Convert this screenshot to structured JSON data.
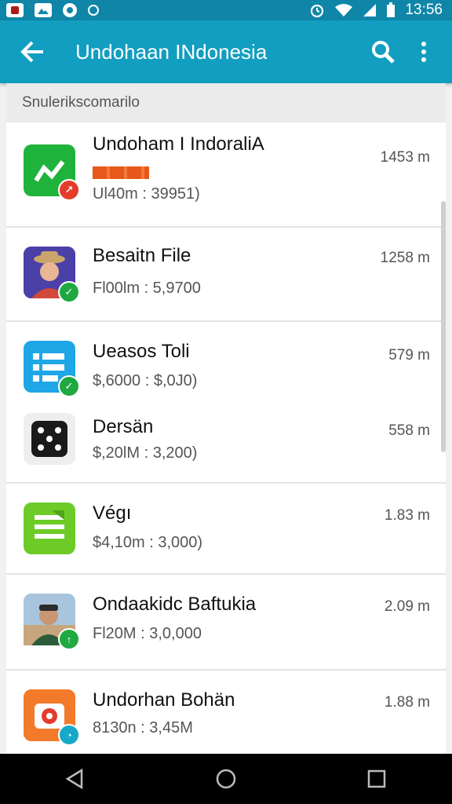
{
  "status_bar": {
    "time": "13:56",
    "left_icons": [
      "notification-app-icon",
      "gallery-icon",
      "messenger-icon",
      "dot-icon"
    ],
    "right_icons": [
      "alarm-icon",
      "wifi-icon",
      "signal-icon",
      "battery-icon"
    ]
  },
  "app_bar": {
    "title": "Undohaan INdonesia",
    "color": "#129ec0"
  },
  "section_header": "Snulerikscomarilo",
  "apps": [
    {
      "name": "Undoham I IndoraliA",
      "sub": "Ul40m : 39951)",
      "size": "1453 m",
      "icon": "green-chart-icon",
      "badge": "red-arrow-badge",
      "progress": true
    },
    {
      "name": "Besaitn File",
      "sub": "Fl00lm : 5,9700",
      "size": "1258 m",
      "icon": "person-avatar-icon",
      "badge": "green-check-badge"
    },
    {
      "name": "Ueasos Toli",
      "sub": "$,6000 : $,0J0)",
      "size": "579 m",
      "icon": "blue-list-icon",
      "badge": "green-check-badge"
    },
    {
      "name": "Dersän",
      "sub": "$,20lM : 3,200)",
      "size": "558 m",
      "icon": "dice-icon"
    },
    {
      "name": "Végı",
      "sub": "$4,10m : 3,000)",
      "size": "1.83 m",
      "icon": "green-doc-icon"
    },
    {
      "name": "Ondaakidc Baftukia",
      "sub": "Fl20M : 3,0,000",
      "size": "2.09 m",
      "icon": "person-photo-icon",
      "badge": "green-up-badge"
    },
    {
      "name": "Undorhan Bohän",
      "sub": "8130n : 3,45M",
      "size": "1.88 m",
      "icon": "orange-camera-icon",
      "badge": "blue-badge"
    }
  ]
}
